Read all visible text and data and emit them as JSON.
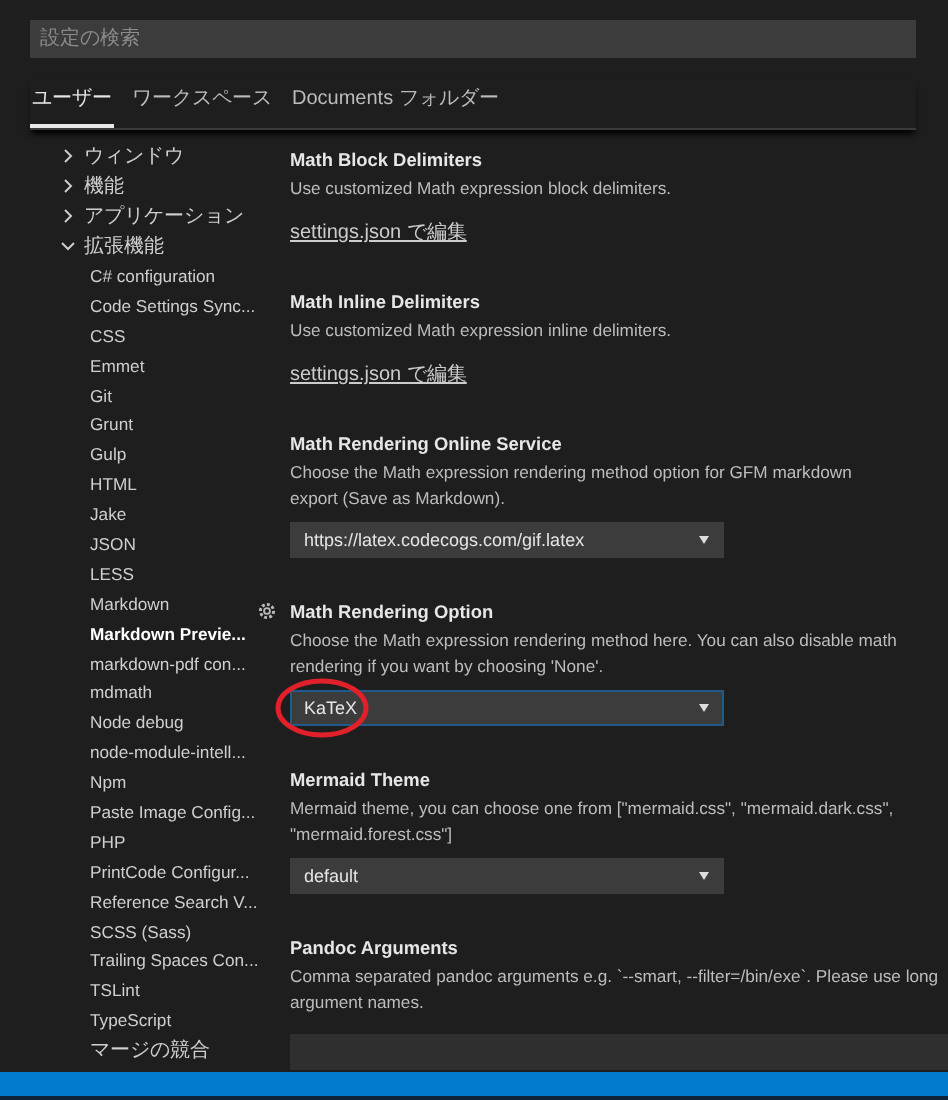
{
  "search": {
    "placeholder": "設定の検索"
  },
  "tabs": [
    {
      "label": "ユーザー",
      "selected": true
    },
    {
      "label": "ワークスペース",
      "selected": false
    },
    {
      "label": "Documents",
      "suffix": "フォルダー",
      "selected": false
    }
  ],
  "sidebar": {
    "items": [
      {
        "label": "ウィンドウ",
        "expanded": false,
        "selected": false
      },
      {
        "label": "機能",
        "expanded": false,
        "selected": false
      },
      {
        "label": "アプリケーション",
        "expanded": false,
        "selected": false
      },
      {
        "label": "拡張機能",
        "expanded": true,
        "selected": false,
        "children": [
          {
            "label": "C# configuration",
            "selected": false
          },
          {
            "label": "Code Settings Sync...",
            "selected": false
          },
          {
            "label": "CSS",
            "selected": false
          },
          {
            "label": "Emmet",
            "selected": false
          },
          {
            "label": "Git",
            "selected": false
          },
          {
            "label": "Grunt",
            "selected": false
          },
          {
            "label": "Gulp",
            "selected": false
          },
          {
            "label": "HTML",
            "selected": false
          },
          {
            "label": "Jake",
            "selected": false
          },
          {
            "label": "JSON",
            "selected": false
          },
          {
            "label": "LESS",
            "selected": false
          },
          {
            "label": "Markdown",
            "selected": false
          },
          {
            "label": "Markdown Previe...",
            "selected": true
          },
          {
            "label": "markdown-pdf con...",
            "selected": false
          },
          {
            "label": "mdmath",
            "selected": false
          },
          {
            "label": "Node debug",
            "selected": false
          },
          {
            "label": "node-module-intell...",
            "selected": false
          },
          {
            "label": "Npm",
            "selected": false
          },
          {
            "label": "Paste Image Config...",
            "selected": false
          },
          {
            "label": "PHP",
            "selected": false
          },
          {
            "label": "PrintCode Configur...",
            "selected": false
          },
          {
            "label": "Reference Search V...",
            "selected": false
          },
          {
            "label": "SCSS (Sass)",
            "selected": false
          },
          {
            "label": "Trailing Spaces Con...",
            "selected": false
          },
          {
            "label": "TSLint",
            "selected": false
          },
          {
            "label": "TypeScript",
            "selected": false
          },
          {
            "label": "マージの競合",
            "selected": false
          }
        ]
      }
    ]
  },
  "settings": [
    {
      "kind": "link",
      "title": "Math Block Delimiters",
      "description": [
        "Use customized Math expression block delimiters."
      ],
      "link": "settings.json で編集"
    },
    {
      "kind": "link",
      "title": "Math Inline Delimiters",
      "description": [
        "Use customized Math expression inline delimiters."
      ],
      "link": "settings.json で編集"
    },
    {
      "kind": "select",
      "title": "Math Rendering Online Service",
      "description": [
        "Choose the Math expression rendering method option for GFM markdown",
        "export (Save as Markdown)."
      ],
      "value": "https://latex.codecogs.com/gif.latex",
      "focused": false
    },
    {
      "kind": "select",
      "title": "Math Rendering Option",
      "description": [
        "Choose the Math expression rendering method here. You can also disable math",
        "rendering if you want by choosing 'None'."
      ],
      "value": "KaTeX",
      "focused": true,
      "circled": true
    },
    {
      "kind": "select",
      "title": "Mermaid Theme",
      "description": [
        "Mermaid theme, you can choose one from [\"mermaid.css\", \"mermaid.dark.css\",",
        "\"mermaid.forest.css\"]"
      ],
      "value": "default",
      "focused": false
    },
    {
      "kind": "text",
      "title": "Pandoc Arguments",
      "description": [
        "Comma separated pandoc arguments e.g. `--smart, --filter=/bin/exe`. Please use long",
        "argument names."
      ]
    }
  ]
}
